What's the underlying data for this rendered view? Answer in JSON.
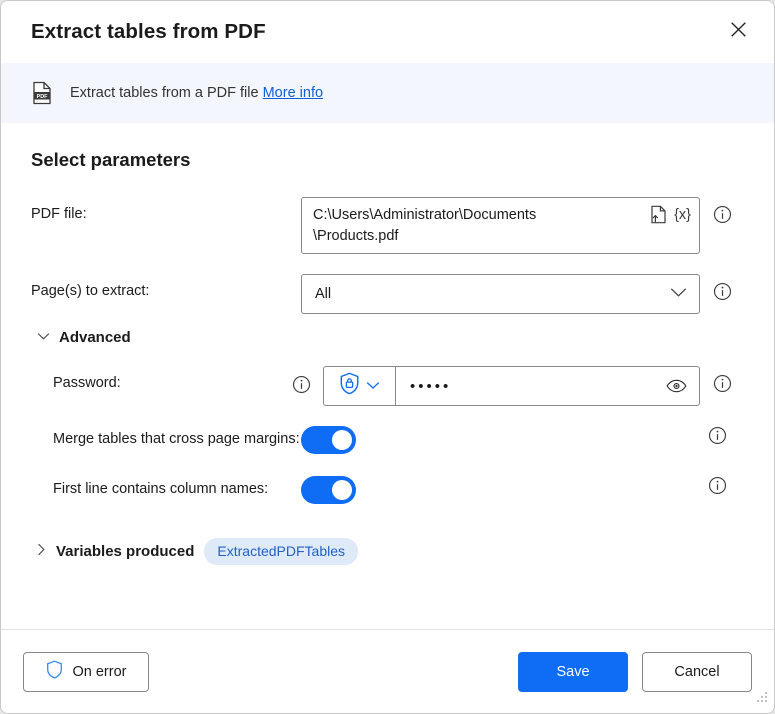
{
  "window": {
    "title": "Extract tables from PDF",
    "close_icon": "close-icon"
  },
  "info_bar": {
    "icon": "pdf-file-icon",
    "text": "Extract tables from a PDF file ",
    "link_label": "More info"
  },
  "main": {
    "section_title": "Select parameters",
    "pdf_file": {
      "label": "PDF file:",
      "value": "C:\\Users\\Administrator\\Documents\n\\Products.pdf",
      "file_picker_icon": "file-upload-icon",
      "variable_button_label": "{x}",
      "info_icon": "info-icon"
    },
    "pages": {
      "label": "Page(s) to extract:",
      "value": "All",
      "chevron_icon": "chevron-down-icon",
      "info_icon": "info-icon"
    },
    "advanced": {
      "label": "Advanced",
      "chevron_icon": "chevron-down-icon",
      "expanded": true
    },
    "password": {
      "label": "Password:",
      "label_info_icon": "info-icon",
      "mode_icon": "shield-lock-icon",
      "mode_chevron_icon": "chevron-down-icon",
      "value": "•••••",
      "reveal_icon": "eye-icon",
      "info_icon": "info-icon"
    },
    "merge_tables": {
      "label": "Merge tables that cross page margins:",
      "state": "on",
      "info_icon": "info-icon"
    },
    "first_line_columns": {
      "label": "First line contains column names:",
      "state": "on",
      "info_icon": "info-icon"
    },
    "variables_produced": {
      "label": "Variables produced",
      "chevron_icon": "chevron-right-icon",
      "badge": "ExtractedPDFTables"
    }
  },
  "footer": {
    "on_error_label": "On error",
    "on_error_icon": "shield-icon",
    "save_label": "Save",
    "cancel_label": "Cancel",
    "resize_grip_icon": "resize-grip-icon"
  },
  "colors": {
    "accent": "#0f6cf5",
    "link": "#0f5fd6",
    "info_bar_bg": "#f3f7fd",
    "badge_bg": "#dfeaf9",
    "badge_text": "#2160c4"
  }
}
